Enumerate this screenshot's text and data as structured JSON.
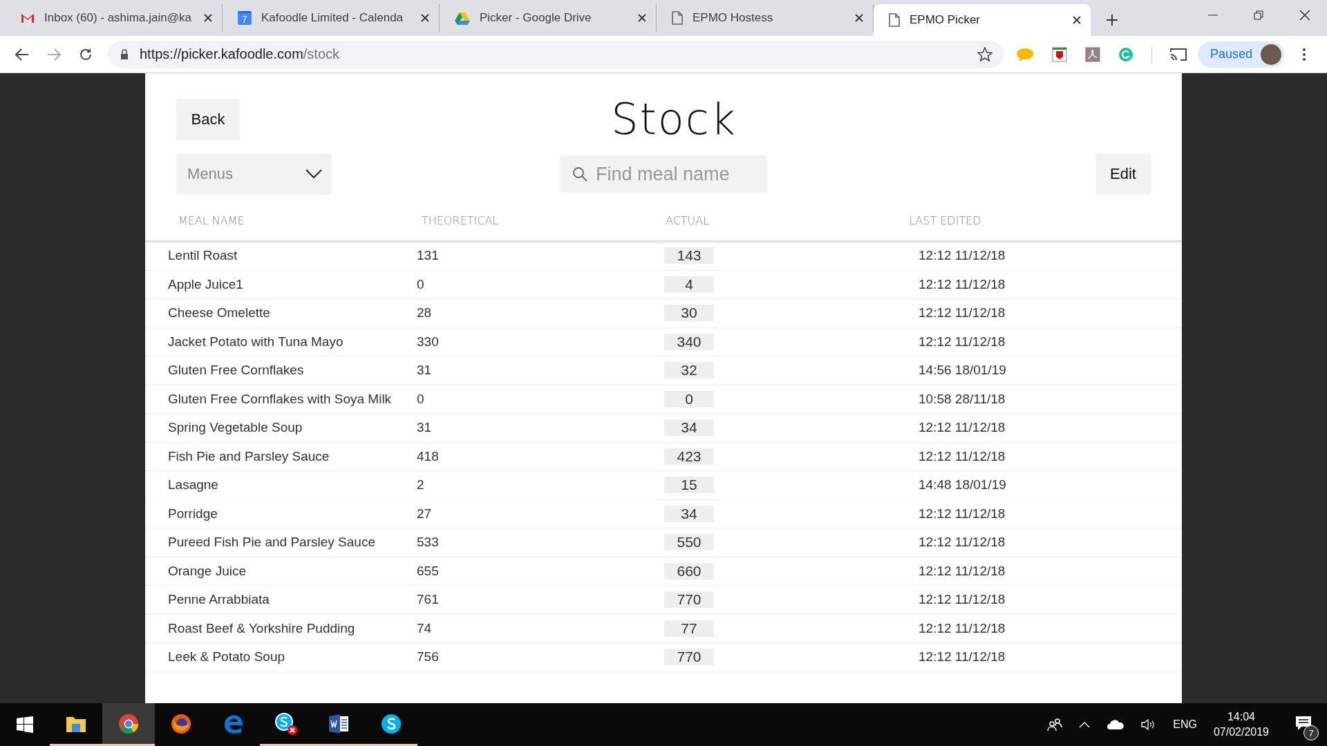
{
  "browser": {
    "tabs": [
      {
        "kind": "gmail",
        "title": "Inbox (60) - ashima.jain@ka",
        "selected": false
      },
      {
        "kind": "calendar",
        "icon_text": "7",
        "title": "Kafoodle Limited - Calenda",
        "selected": false
      },
      {
        "kind": "drive",
        "title": "Picker - Google Drive",
        "selected": false
      },
      {
        "kind": "page",
        "title": "EPMO Hostess",
        "selected": false
      },
      {
        "kind": "page",
        "title": "EPMO Picker",
        "selected": true
      }
    ],
    "url_host": "https://picker.kafoodle.com",
    "url_path": "/stock",
    "profile_label": "Paused"
  },
  "page": {
    "title": "Stock",
    "back_button": "Back",
    "menus_dropdown": {
      "placeholder": "Menus"
    },
    "search": {
      "placeholder": "Find meal name"
    },
    "edit_button": "Edit",
    "table": {
      "columns": [
        "MEAL NAME",
        "THEORETICAL",
        "ACTUAL",
        "LAST EDITED"
      ],
      "rows": [
        {
          "meal_name": "Lentil Roast",
          "theoretical": "131",
          "actual": "143",
          "last_edited": "12:12 11/12/18"
        },
        {
          "meal_name": "Apple Juice1",
          "theoretical": "0",
          "actual": "4",
          "last_edited": "12:12 11/12/18"
        },
        {
          "meal_name": "Cheese Omelette",
          "theoretical": "28",
          "actual": "30",
          "last_edited": "12:12 11/12/18"
        },
        {
          "meal_name": "Jacket Potato with Tuna Mayo",
          "theoretical": "330",
          "actual": "340",
          "last_edited": "12:12 11/12/18"
        },
        {
          "meal_name": "Gluten Free Cornflakes",
          "theoretical": "31",
          "actual": "32",
          "last_edited": "14:56 18/01/19"
        },
        {
          "meal_name": "Gluten Free Cornflakes with Soya Milk",
          "theoretical": "0",
          "actual": "0",
          "last_edited": "10:58 28/11/18"
        },
        {
          "meal_name": "Spring Vegetable Soup",
          "theoretical": "31",
          "actual": "34",
          "last_edited": "12:12 11/12/18"
        },
        {
          "meal_name": "Fish Pie and Parsley Sauce",
          "theoretical": "418",
          "actual": "423",
          "last_edited": "12:12 11/12/18"
        },
        {
          "meal_name": "Lasagne",
          "theoretical": "2",
          "actual": "15",
          "last_edited": "14:48 18/01/19"
        },
        {
          "meal_name": "Porridge",
          "theoretical": "27",
          "actual": "34",
          "last_edited": "12:12 11/12/18"
        },
        {
          "meal_name": "Pureed Fish Pie and Parsley Sauce",
          "theoretical": "533",
          "actual": "550",
          "last_edited": "12:12 11/12/18"
        },
        {
          "meal_name": "Orange Juice",
          "theoretical": "655",
          "actual": "660",
          "last_edited": "12:12 11/12/18"
        },
        {
          "meal_name": "Penne Arrabbiata",
          "theoretical": "761",
          "actual": "770",
          "last_edited": "12:12 11/12/18"
        },
        {
          "meal_name": "Roast Beef & Yorkshire Pudding",
          "theoretical": "74",
          "actual": "77",
          "last_edited": "12:12 11/12/18"
        },
        {
          "meal_name": "Leek & Potato Soup",
          "theoretical": "756",
          "actual": "770",
          "last_edited": "12:12 11/12/18"
        }
      ]
    }
  },
  "taskbar": {
    "apps": [
      {
        "kind": "files",
        "open": true,
        "selected": false
      },
      {
        "kind": "chrome",
        "open": true,
        "selected": true
      },
      {
        "kind": "firefox",
        "open": false,
        "selected": false
      },
      {
        "kind": "edge",
        "open": false,
        "selected": false
      },
      {
        "kind": "skype-error",
        "open": true,
        "selected": false
      },
      {
        "kind": "word",
        "open": true,
        "selected": false
      },
      {
        "kind": "skype",
        "open": true,
        "selected": false
      }
    ],
    "language": "ENG",
    "time": "14:04",
    "date": "07/02/2019",
    "notification_count": "7"
  }
}
